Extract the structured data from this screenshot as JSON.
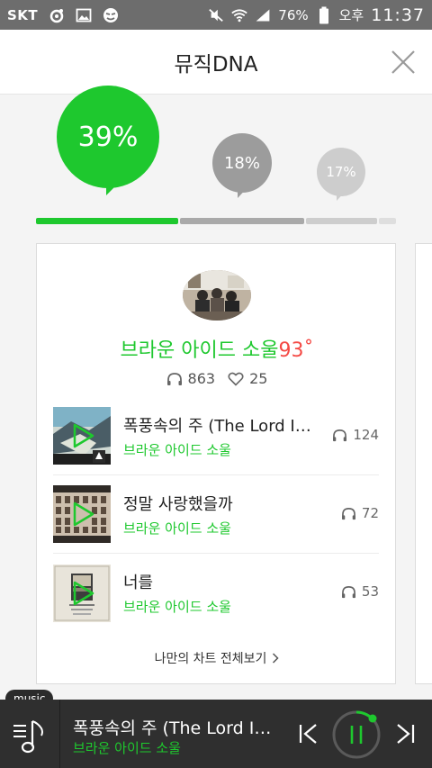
{
  "status_bar": {
    "carrier": "SKT",
    "battery": "76%",
    "ampm": "오후",
    "time": "11:37"
  },
  "header": {
    "title": "뮤직DNA"
  },
  "dna_bubbles": [
    {
      "percent": "39%",
      "fraction": 0.39,
      "color": "#1ec82e"
    },
    {
      "percent": "18%",
      "fraction": 0.18,
      "color": "#9c9c9c"
    },
    {
      "percent": "17%",
      "fraction": 0.17,
      "color": "#cdcdcd"
    }
  ],
  "card": {
    "genre": "브라운 아이드 소울",
    "temperature": "93˚",
    "listens": "863",
    "likes": "25",
    "tracks": [
      {
        "title": "폭풍속의 주 (The Lord In The Storm)",
        "artist": "브라운 아이드 소울",
        "count": "124"
      },
      {
        "title": "정말 사랑했을까",
        "artist": "브라운 아이드 소울",
        "count": "72"
      },
      {
        "title": "너를",
        "artist": "브라운 아이드 소울",
        "count": "53"
      }
    ],
    "more_link": "나만의 차트 전체보기"
  },
  "music_tag": "music",
  "player": {
    "title": "폭풍속의 주 (The Lord In The Storm)",
    "artist": "브라운 아이드 소울",
    "progress": 0.03
  },
  "colors": {
    "accent": "#1ec82e",
    "temperature": "#f44a45",
    "player_bg": "#2f2f2f"
  }
}
